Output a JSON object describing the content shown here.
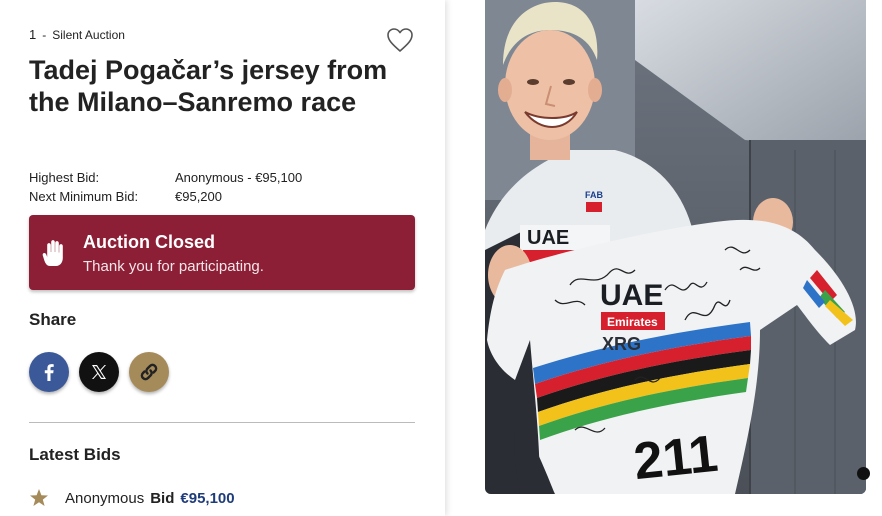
{
  "lot": {
    "number": "1",
    "separator": "-",
    "type": "Silent Auction"
  },
  "title": "Tadej Pogačar’s jersey from the Milano–Sanremo race",
  "bids": {
    "highest_label": "Highest Bid:",
    "highest_value": "Anonymous - €95,100",
    "next_label": "Next Minimum Bid:",
    "next_value": "€95,200"
  },
  "status": {
    "title": "Auction Closed",
    "subtitle": "Thank you for participating.",
    "color": "#8c1e36"
  },
  "share": {
    "heading": "Share",
    "buttons": [
      {
        "icon": "facebook-icon",
        "color": "#3b5998"
      },
      {
        "icon": "x-icon",
        "color": "#111111"
      },
      {
        "icon": "link-icon",
        "color": "#a58a5a"
      }
    ]
  },
  "latest_bids": {
    "heading": "Latest Bids",
    "items": [
      {
        "bidder": "Anonymous",
        "label": "Bid",
        "amount": "€95,100"
      }
    ]
  },
  "jersey_print": {
    "sponsor_main": "UAE",
    "sponsor_banner": "Emirates",
    "brand": "XRG",
    "race_number": "211",
    "chest_logo": "FAB"
  }
}
